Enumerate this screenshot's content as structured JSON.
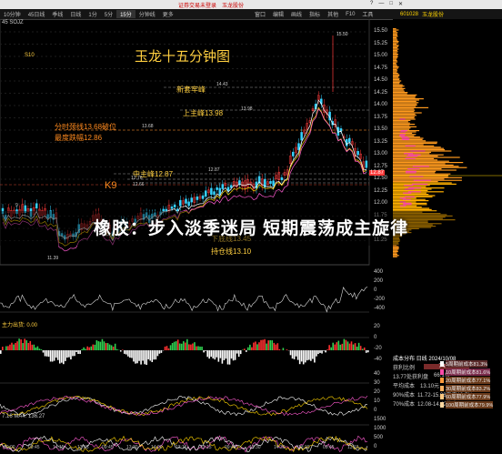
{
  "window": {
    "notice": "证券交易未登录",
    "notice_link": "玉龙股份",
    "controls": [
      "?",
      "—",
      "□",
      "✕"
    ]
  },
  "toolbar": {
    "periods": [
      "10分钟",
      "45日线",
      "季线",
      "日线",
      "1分",
      "5分",
      "15分",
      "分钟线",
      "更多"
    ],
    "active_period": "15分",
    "menu_right": [
      "首页",
      "F10",
      "诊股"
    ],
    "stock_code": "601028",
    "stock_name": "玉龙股份",
    "tabs_mid": [
      "窗口",
      "编辑",
      "画线",
      "指标",
      "其他",
      "F10",
      "工具"
    ]
  },
  "chart": {
    "title": "玉龙十五分钟图",
    "label_ma": "45 SOJZ",
    "label_left_top": "S10",
    "annotations": {
      "xintao": "新套牢峰",
      "shangzhu": "上主峰13.98",
      "zhongzhu": "中主峰12.87",
      "fenshi": "分时颈线13.68破位",
      "diefu": "最度跌幅12.86",
      "k9": "K9",
      "xiadi": "下底线13.45",
      "chicang": "持仓线13.10"
    },
    "small_labels": {
      "peak": "15.50",
      "l1443": "14.43",
      "l1398": "13.98",
      "l1368": "13.68",
      "l1287": "12.87",
      "l1276": "12.76",
      "l1266": "12.66",
      "low": "11.39",
      "l9": "9"
    },
    "price_axis": [
      "15.50",
      "15.25",
      "15.00",
      "14.75",
      "14.50",
      "14.25",
      "14.00",
      "13.75",
      "13.50",
      "13.25",
      "13.00",
      "12.75",
      "12.50",
      "12.25",
      "12.00",
      "11.75",
      "11.50",
      "11.25"
    ],
    "current_price": "12.87",
    "sub_axis1": [
      "400",
      "200",
      "0",
      "-200",
      "-400"
    ],
    "sub_label2": "主力出货: 0.00",
    "sub_axis2": [
      "20",
      "0",
      "-20",
      "-40"
    ],
    "sub_axis3": [
      "40",
      "30",
      "20",
      "10",
      "0"
    ],
    "sub_label4": "7.16  MA4: 136.27",
    "sub_axis4": [
      "1500",
      "1000",
      "500",
      "0"
    ],
    "time_axis": [
      "10:00",
      "09:45",
      "14:15",
      "13:15",
      "09:45",
      "13:30",
      "14:00",
      "13:15",
      "13:15",
      "09:45",
      "13:30",
      "14:30",
      "13:15",
      "09:45",
      "13:15"
    ],
    "colors": {
      "up": "#ff3b3b",
      "down": "#36d2ff",
      "level": "#aaaaaa",
      "annot": "#ffcf40",
      "orange": "#ff8a1e"
    }
  },
  "chip_table": {
    "header_date": "成本分布 日线 2024/10/08",
    "rows": [
      {
        "label": "获利比例",
        "value": "74.6%"
      },
      {
        "label": "13.77处获利盘",
        "value": "66.1%"
      },
      {
        "label": "平均成本",
        "value": "13.10元"
      },
      {
        "label": "90%成本",
        "value": "11.72-15.08集中19.5%"
      },
      {
        "label": "70%成本",
        "value": "12.08-14.42集中17.8%"
      }
    ],
    "legend": [
      {
        "label": "5周期前成本81.3%",
        "color": "#ffffff"
      },
      {
        "label": "10周期前成本81.6%",
        "color": "#ff4aa8"
      },
      {
        "label": "20周期前成本77.1%",
        "color": "#ff9a3c"
      },
      {
        "label": "30周期前成本83.2%",
        "color": "#ffb060"
      },
      {
        "label": "60周期前成本77.9%",
        "color": "#ffc880"
      },
      {
        "label": "100周期前成本79.9%",
        "color": "#ffd8a0"
      }
    ]
  },
  "overlay": {
    "headline": "橡胶：步入淡季迷局 短期震荡成主旋律"
  }
}
